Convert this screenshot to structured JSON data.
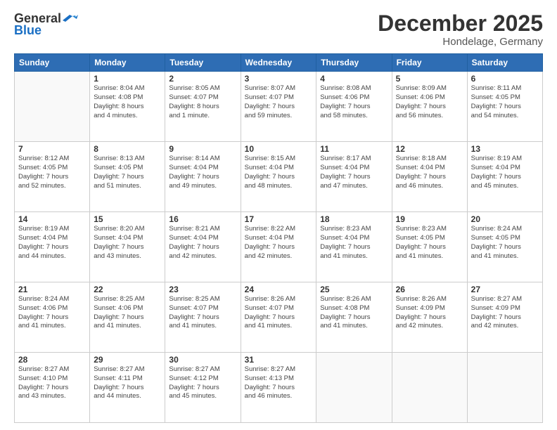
{
  "logo": {
    "general": "General",
    "blue": "Blue"
  },
  "title": "December 2025",
  "location": "Hondelage, Germany",
  "days_of_week": [
    "Sunday",
    "Monday",
    "Tuesday",
    "Wednesday",
    "Thursday",
    "Friday",
    "Saturday"
  ],
  "weeks": [
    [
      {
        "day": "",
        "info": ""
      },
      {
        "day": "1",
        "info": "Sunrise: 8:04 AM\nSunset: 4:08 PM\nDaylight: 8 hours\nand 4 minutes."
      },
      {
        "day": "2",
        "info": "Sunrise: 8:05 AM\nSunset: 4:07 PM\nDaylight: 8 hours\nand 1 minute."
      },
      {
        "day": "3",
        "info": "Sunrise: 8:07 AM\nSunset: 4:07 PM\nDaylight: 7 hours\nand 59 minutes."
      },
      {
        "day": "4",
        "info": "Sunrise: 8:08 AM\nSunset: 4:06 PM\nDaylight: 7 hours\nand 58 minutes."
      },
      {
        "day": "5",
        "info": "Sunrise: 8:09 AM\nSunset: 4:06 PM\nDaylight: 7 hours\nand 56 minutes."
      },
      {
        "day": "6",
        "info": "Sunrise: 8:11 AM\nSunset: 4:05 PM\nDaylight: 7 hours\nand 54 minutes."
      }
    ],
    [
      {
        "day": "7",
        "info": "Sunrise: 8:12 AM\nSunset: 4:05 PM\nDaylight: 7 hours\nand 52 minutes."
      },
      {
        "day": "8",
        "info": "Sunrise: 8:13 AM\nSunset: 4:05 PM\nDaylight: 7 hours\nand 51 minutes."
      },
      {
        "day": "9",
        "info": "Sunrise: 8:14 AM\nSunset: 4:04 PM\nDaylight: 7 hours\nand 49 minutes."
      },
      {
        "day": "10",
        "info": "Sunrise: 8:15 AM\nSunset: 4:04 PM\nDaylight: 7 hours\nand 48 minutes."
      },
      {
        "day": "11",
        "info": "Sunrise: 8:17 AM\nSunset: 4:04 PM\nDaylight: 7 hours\nand 47 minutes."
      },
      {
        "day": "12",
        "info": "Sunrise: 8:18 AM\nSunset: 4:04 PM\nDaylight: 7 hours\nand 46 minutes."
      },
      {
        "day": "13",
        "info": "Sunrise: 8:19 AM\nSunset: 4:04 PM\nDaylight: 7 hours\nand 45 minutes."
      }
    ],
    [
      {
        "day": "14",
        "info": "Sunrise: 8:19 AM\nSunset: 4:04 PM\nDaylight: 7 hours\nand 44 minutes."
      },
      {
        "day": "15",
        "info": "Sunrise: 8:20 AM\nSunset: 4:04 PM\nDaylight: 7 hours\nand 43 minutes."
      },
      {
        "day": "16",
        "info": "Sunrise: 8:21 AM\nSunset: 4:04 PM\nDaylight: 7 hours\nand 42 minutes."
      },
      {
        "day": "17",
        "info": "Sunrise: 8:22 AM\nSunset: 4:04 PM\nDaylight: 7 hours\nand 42 minutes."
      },
      {
        "day": "18",
        "info": "Sunrise: 8:23 AM\nSunset: 4:04 PM\nDaylight: 7 hours\nand 41 minutes."
      },
      {
        "day": "19",
        "info": "Sunrise: 8:23 AM\nSunset: 4:05 PM\nDaylight: 7 hours\nand 41 minutes."
      },
      {
        "day": "20",
        "info": "Sunrise: 8:24 AM\nSunset: 4:05 PM\nDaylight: 7 hours\nand 41 minutes."
      }
    ],
    [
      {
        "day": "21",
        "info": "Sunrise: 8:24 AM\nSunset: 4:06 PM\nDaylight: 7 hours\nand 41 minutes."
      },
      {
        "day": "22",
        "info": "Sunrise: 8:25 AM\nSunset: 4:06 PM\nDaylight: 7 hours\nand 41 minutes."
      },
      {
        "day": "23",
        "info": "Sunrise: 8:25 AM\nSunset: 4:07 PM\nDaylight: 7 hours\nand 41 minutes."
      },
      {
        "day": "24",
        "info": "Sunrise: 8:26 AM\nSunset: 4:07 PM\nDaylight: 7 hours\nand 41 minutes."
      },
      {
        "day": "25",
        "info": "Sunrise: 8:26 AM\nSunset: 4:08 PM\nDaylight: 7 hours\nand 41 minutes."
      },
      {
        "day": "26",
        "info": "Sunrise: 8:26 AM\nSunset: 4:09 PM\nDaylight: 7 hours\nand 42 minutes."
      },
      {
        "day": "27",
        "info": "Sunrise: 8:27 AM\nSunset: 4:09 PM\nDaylight: 7 hours\nand 42 minutes."
      }
    ],
    [
      {
        "day": "28",
        "info": "Sunrise: 8:27 AM\nSunset: 4:10 PM\nDaylight: 7 hours\nand 43 minutes."
      },
      {
        "day": "29",
        "info": "Sunrise: 8:27 AM\nSunset: 4:11 PM\nDaylight: 7 hours\nand 44 minutes."
      },
      {
        "day": "30",
        "info": "Sunrise: 8:27 AM\nSunset: 4:12 PM\nDaylight: 7 hours\nand 45 minutes."
      },
      {
        "day": "31",
        "info": "Sunrise: 8:27 AM\nSunset: 4:13 PM\nDaylight: 7 hours\nand 46 minutes."
      },
      {
        "day": "",
        "info": ""
      },
      {
        "day": "",
        "info": ""
      },
      {
        "day": "",
        "info": ""
      }
    ]
  ]
}
